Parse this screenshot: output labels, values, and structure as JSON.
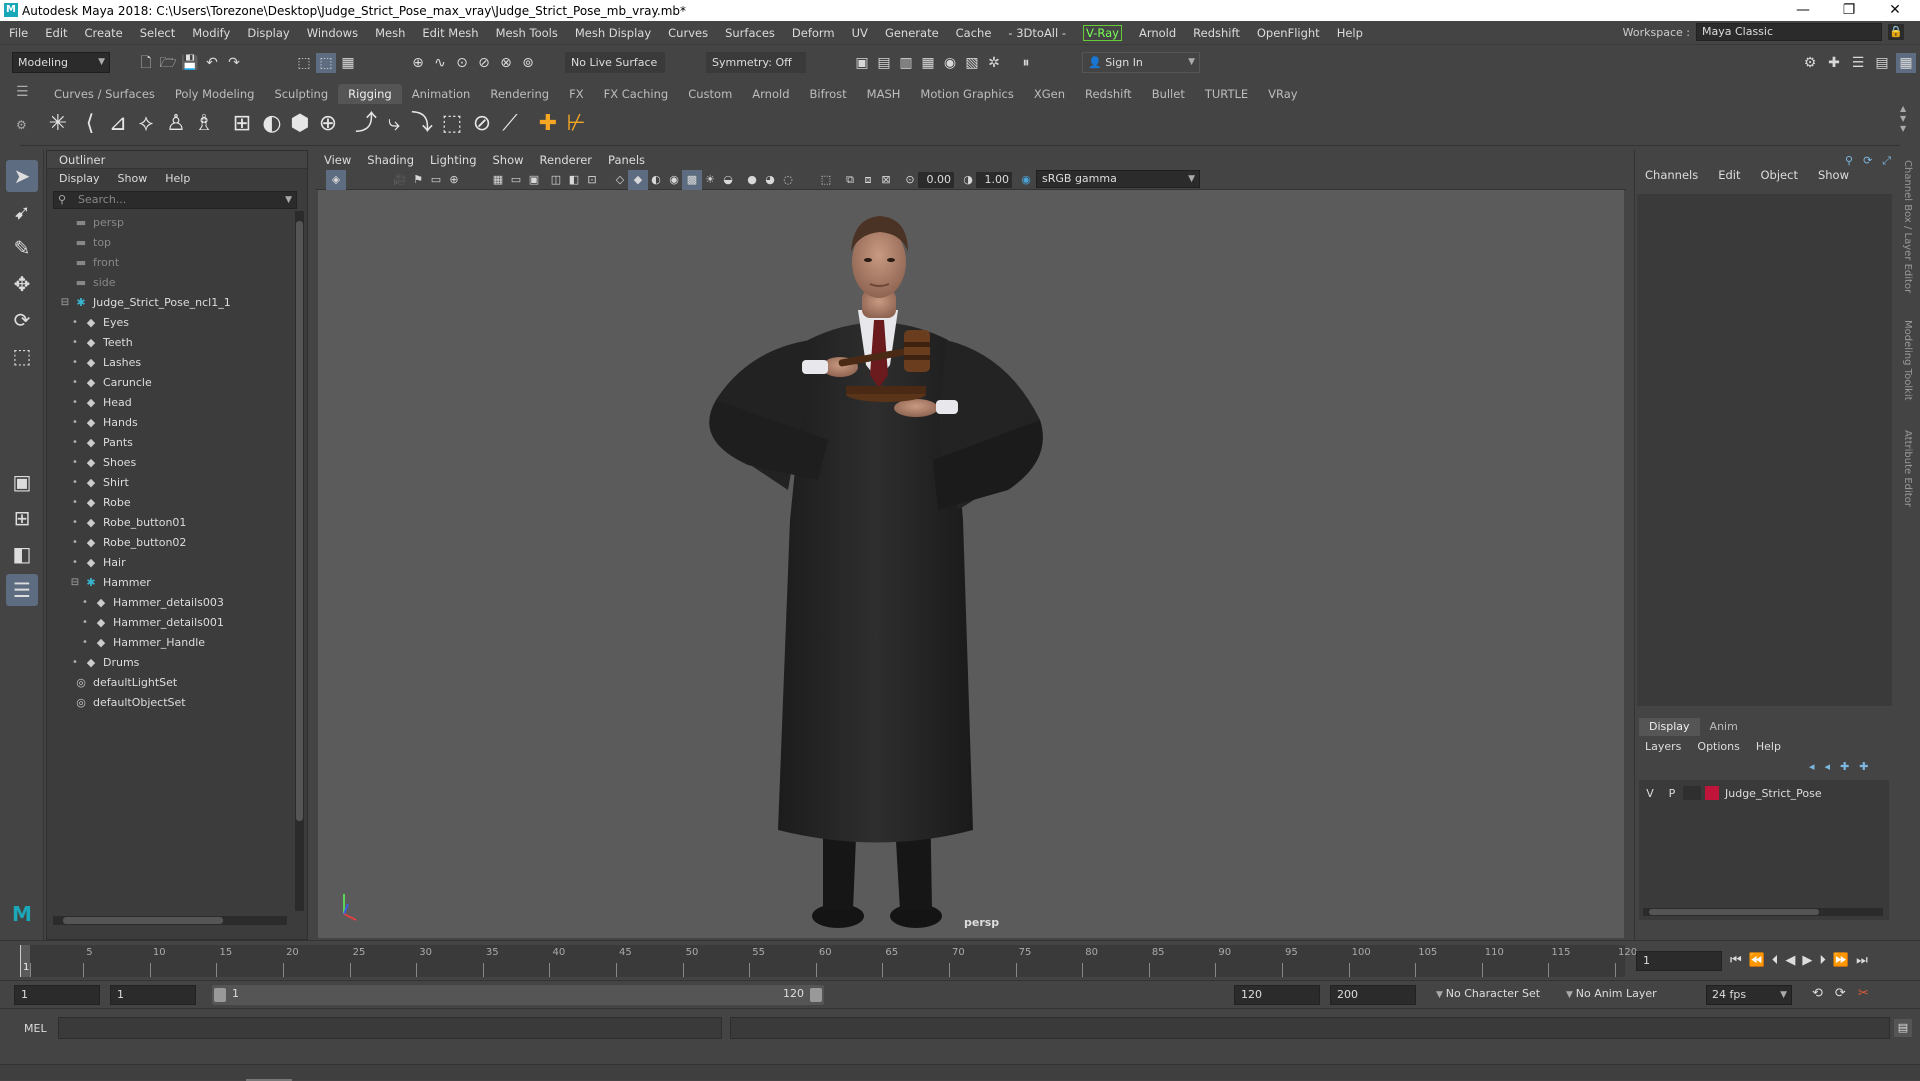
{
  "titlebar": {
    "title": "Autodesk Maya 2018: C:\\Users\\Torezone\\Desktop\\Judge_Strict_Pose_max_vray\\Judge_Strict_Pose_mb_vray.mb*",
    "logo": "M"
  },
  "menubar": {
    "items": [
      "File",
      "Edit",
      "Create",
      "Select",
      "Modify",
      "Display",
      "Windows",
      "Mesh",
      "Edit Mesh",
      "Mesh Tools",
      "Mesh Display",
      "Curves",
      "Surfaces",
      "Deform",
      "UV",
      "Generate",
      "Cache",
      "- 3DtoAll -",
      "V-Ray",
      "Arnold",
      "Redshift",
      "OpenFlight",
      "Help"
    ],
    "workspace_label": "Workspace :",
    "workspace_value": "Maya Classic"
  },
  "statusline": {
    "mode": "Modeling",
    "live_surface": "No Live Surface",
    "symmetry": "Symmetry: Off",
    "sign_in": "Sign In"
  },
  "shelf": {
    "tabs": [
      "Curves / Surfaces",
      "Poly Modeling",
      "Sculpting",
      "Rigging",
      "Animation",
      "Rendering",
      "FX",
      "FX Caching",
      "Custom",
      "Arnold",
      "Bifrost",
      "MASH",
      "Motion Graphics",
      "XGen",
      "Redshift",
      "Bullet",
      "TURTLE",
      "VRay"
    ],
    "active_tab": "Rigging"
  },
  "outliner": {
    "title": "Outliner",
    "menu": [
      "Display",
      "Show",
      "Help"
    ],
    "search_placeholder": "Search...",
    "items": [
      {
        "label": "persp",
        "type": "camera",
        "depth": 0
      },
      {
        "label": "top",
        "type": "camera",
        "depth": 0
      },
      {
        "label": "front",
        "type": "camera",
        "depth": 0
      },
      {
        "label": "side",
        "type": "camera",
        "depth": 0
      },
      {
        "label": "Judge_Strict_Pose_ncl1_1",
        "type": "group",
        "depth": 0,
        "expanded": true
      },
      {
        "label": "Eyes",
        "type": "mesh",
        "depth": 1
      },
      {
        "label": "Teeth",
        "type": "mesh",
        "depth": 1
      },
      {
        "label": "Lashes",
        "type": "mesh",
        "depth": 1
      },
      {
        "label": "Caruncle",
        "type": "mesh",
        "depth": 1
      },
      {
        "label": "Head",
        "type": "mesh",
        "depth": 1
      },
      {
        "label": "Hands",
        "type": "mesh",
        "depth": 1
      },
      {
        "label": "Pants",
        "type": "mesh",
        "depth": 1
      },
      {
        "label": "Shoes",
        "type": "mesh",
        "depth": 1
      },
      {
        "label": "Shirt",
        "type": "mesh",
        "depth": 1
      },
      {
        "label": "Robe",
        "type": "mesh",
        "depth": 1
      },
      {
        "label": "Robe_button01",
        "type": "mesh",
        "depth": 1
      },
      {
        "label": "Robe_button02",
        "type": "mesh",
        "depth": 1
      },
      {
        "label": "Hair",
        "type": "mesh",
        "depth": 1
      },
      {
        "label": "Hammer",
        "type": "group",
        "depth": 1,
        "expanded": true
      },
      {
        "label": "Hammer_details003",
        "type": "mesh",
        "depth": 2
      },
      {
        "label": "Hammer_details001",
        "type": "mesh",
        "depth": 2
      },
      {
        "label": "Hammer_Handle",
        "type": "mesh",
        "depth": 2
      },
      {
        "label": "Drums",
        "type": "mesh",
        "depth": 1
      },
      {
        "label": "defaultLightSet",
        "type": "set",
        "depth": 0
      },
      {
        "label": "defaultObjectSet",
        "type": "set",
        "depth": 0
      }
    ]
  },
  "viewport": {
    "menu": [
      "View",
      "Shading",
      "Lighting",
      "Show",
      "Renderer",
      "Panels"
    ],
    "exposure": "0.00",
    "gamma": "1.00",
    "color_space": "sRGB gamma",
    "camera_label": "persp"
  },
  "channelbox": {
    "menu": [
      "Channels",
      "Edit",
      "Object",
      "Show"
    ],
    "layer_tabs": [
      "Display",
      "Anim"
    ],
    "layer_menu": [
      "Layers",
      "Options",
      "Help"
    ],
    "layer": {
      "v": "V",
      "p": "P",
      "name": "Judge_Strict_Pose",
      "color": "#c0143a"
    }
  },
  "side_tabs": [
    "Channel Box / Layer Editor",
    "Modeling Toolkit",
    "Attribute Editor"
  ],
  "timeslider": {
    "ticks": [
      1,
      5,
      10,
      15,
      20,
      25,
      30,
      35,
      40,
      45,
      50,
      55,
      60,
      65,
      70,
      75,
      80,
      85,
      90,
      95,
      100,
      105,
      110,
      115,
      120
    ],
    "current_frame": "1",
    "frame_field": "1"
  },
  "rangebar": {
    "start": "1",
    "playback_start": "1",
    "slider_start": "1",
    "slider_end": "120",
    "playback_end": "120",
    "end": "200",
    "character_set": "No Character Set",
    "anim_layer": "No Anim Layer",
    "fps": "24 fps"
  },
  "cmdline": {
    "lang": "MEL"
  },
  "colors": {
    "accent": "#5d6c80",
    "panel": "#444444",
    "field": "#2b2b2b",
    "scene": "#5b5b5b"
  }
}
